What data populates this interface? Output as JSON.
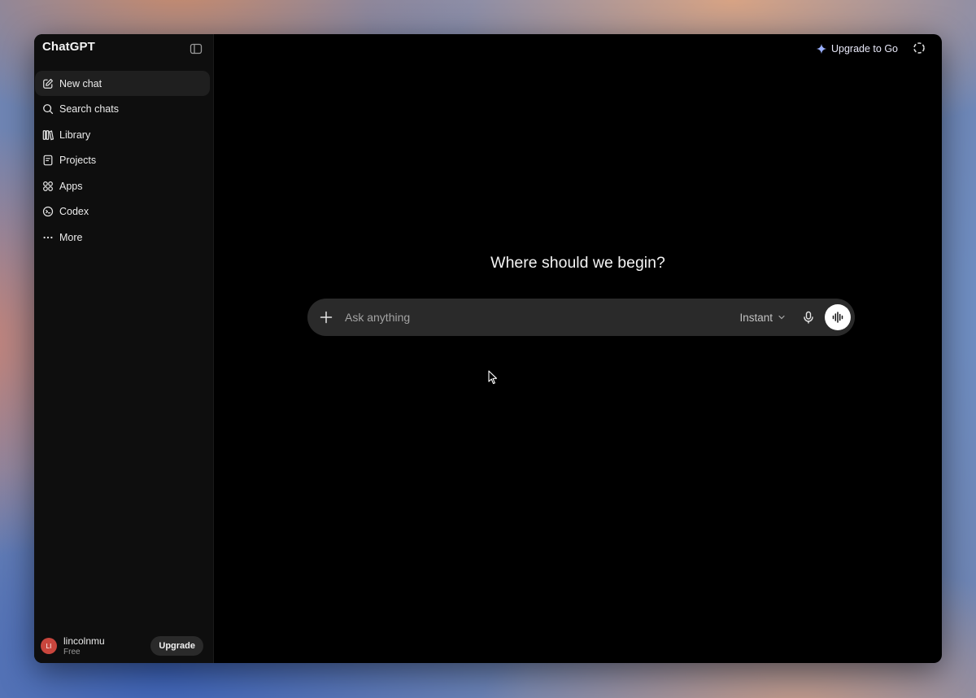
{
  "app": {
    "title": "ChatGPT"
  },
  "sidebar": {
    "items": [
      {
        "label": "New chat",
        "icon": "compose-icon",
        "active": true
      },
      {
        "label": "Search chats",
        "icon": "search-icon"
      },
      {
        "label": "Library",
        "icon": "library-icon"
      },
      {
        "label": "Projects",
        "icon": "projects-icon"
      },
      {
        "label": "Apps",
        "icon": "apps-icon"
      },
      {
        "label": "Codex",
        "icon": "codex-icon"
      },
      {
        "label": "More",
        "icon": "more-icon"
      }
    ],
    "user": {
      "initials": "LI",
      "name": "lincolnmu",
      "plan": "Free",
      "upgrade_label": "Upgrade"
    }
  },
  "header": {
    "upgrade_label": "Upgrade to Go"
  },
  "main": {
    "headline": "Where should we begin?",
    "composer": {
      "placeholder": "Ask anything",
      "mode": "Instant"
    }
  },
  "colors": {
    "window_bg": "#000000",
    "sidebar_bg": "#0e0e0e",
    "composer_bg": "#2a2a2a",
    "avatar": "#c9463d"
  }
}
